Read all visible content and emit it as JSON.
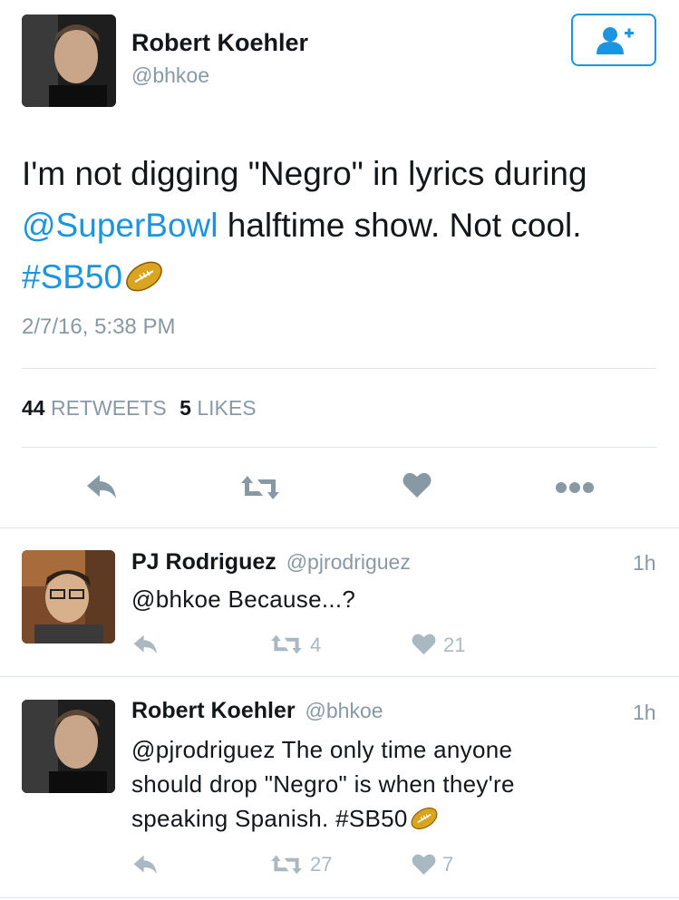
{
  "main_tweet": {
    "author": {
      "name": "Robert Koehler",
      "handle": "@bhkoe"
    },
    "text": {
      "line1": "I'm not digging \"Negro\" in lyrics during",
      "mention": "@SuperBowl",
      "line2_rest": " halftime show. Not cool.",
      "hashtag": "#SB50"
    },
    "timestamp": "2/7/16, 5:38 PM",
    "stats": {
      "retweets_count": "44",
      "retweets_label": "RETWEETS",
      "likes_count": "5",
      "likes_label": "LIKES"
    },
    "actions": [
      "reply-icon",
      "retweet-icon",
      "heart-icon",
      "more-icon"
    ],
    "follow_icon": "follow-user-icon"
  },
  "replies": [
    {
      "name": "PJ Rodriguez",
      "handle": "@pjrodriguez",
      "time": "1h",
      "text": "@bhkoe Because...?",
      "retweets": "4",
      "likes": "21"
    },
    {
      "name": "Robert Koehler",
      "handle": "@bhkoe",
      "time": "1h",
      "text_line1": "@pjrodriguez The only time anyone",
      "text_line2": "should drop \"Negro\" is when they're",
      "text_line3": "speaking Spanish. #SB50",
      "retweets": "27",
      "likes": "7"
    }
  ],
  "colors": {
    "link": "#1b95e0",
    "muted": "#8899a6",
    "divider": "#e1e8ed",
    "action": "#8899a6"
  }
}
